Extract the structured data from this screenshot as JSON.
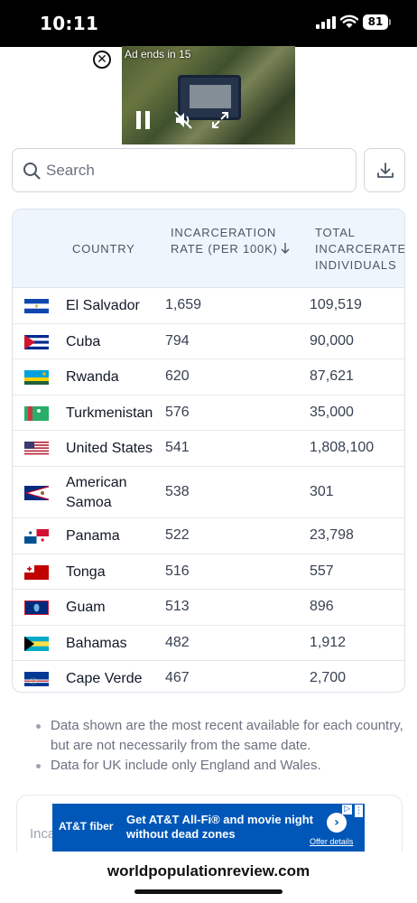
{
  "status_bar": {
    "time": "10:11",
    "battery": "81"
  },
  "video_ad": {
    "countdown": "Ad ends in 15"
  },
  "search": {
    "placeholder": "Search"
  },
  "table": {
    "headers": {
      "country": "COUNTRY",
      "rate": "INCARCERATION RATE (PER 100K)",
      "total": "TOTAL INCARCERATED INDIVIDUALS"
    },
    "rows": [
      {
        "flag": "el-salvador-flag",
        "country": "El Salvador",
        "rate": "1,659",
        "total": "109,519"
      },
      {
        "flag": "cuba-flag",
        "country": "Cuba",
        "rate": "794",
        "total": "90,000"
      },
      {
        "flag": "rwanda-flag",
        "country": "Rwanda",
        "rate": "620",
        "total": "87,621"
      },
      {
        "flag": "turkmenistan-flag",
        "country": "Turkmenistan",
        "rate": "576",
        "total": "35,000"
      },
      {
        "flag": "united-states-flag",
        "country": "United States",
        "rate": "541",
        "total": "1,808,100"
      },
      {
        "flag": "american-samoa-flag",
        "country": "American Samoa",
        "rate": "538",
        "total": "301"
      },
      {
        "flag": "panama-flag",
        "country": "Panama",
        "rate": "522",
        "total": "23,798"
      },
      {
        "flag": "tonga-flag",
        "country": "Tonga",
        "rate": "516",
        "total": "557"
      },
      {
        "flag": "guam-flag",
        "country": "Guam",
        "rate": "513",
        "total": "896"
      },
      {
        "flag": "bahamas-flag",
        "country": "Bahamas",
        "rate": "482",
        "total": "1,912"
      },
      {
        "flag": "cape-verde-flag",
        "country": "Cape Verde",
        "rate": "467",
        "total": "2,700"
      }
    ]
  },
  "notes": [
    "Data shown are the most recent available for each country, but are not necessarily from the same date.",
    "Data for UK include only England and Wales."
  ],
  "next_card": {
    "text": "Inca"
  },
  "bottom_ad": {
    "brand": "AT&T fiber",
    "headline": "Get AT&T All-Fi® and movie night without dead zones",
    "offer": "Offer details"
  },
  "url_bar": {
    "domain": "worldpopulationreview.com"
  }
}
